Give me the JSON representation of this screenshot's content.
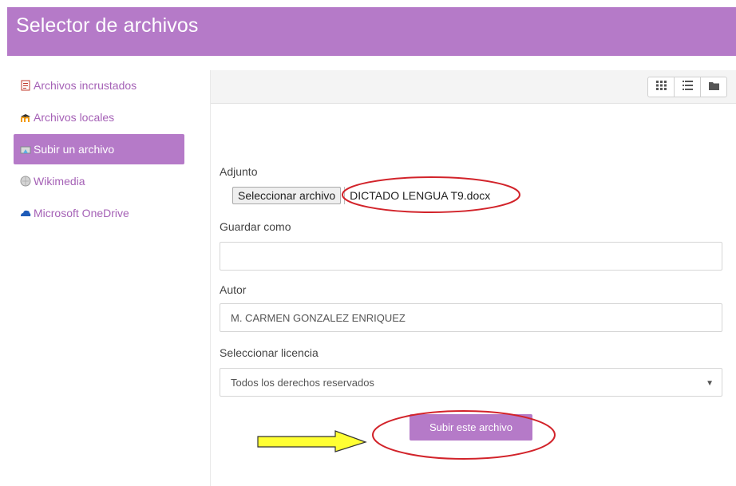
{
  "header": {
    "title": "Selector de archivos"
  },
  "sidebar": {
    "items": [
      {
        "label": "Archivos incrustados",
        "icon": "embedded-files-icon",
        "active": false
      },
      {
        "label": "Archivos locales",
        "icon": "moodle-local-files-icon",
        "active": false
      },
      {
        "label": "Subir un archivo",
        "icon": "upload-icon",
        "active": true
      },
      {
        "label": "Wikimedia",
        "icon": "wikimedia-icon",
        "active": false
      },
      {
        "label": "Microsoft OneDrive",
        "icon": "onedrive-cloud-icon",
        "active": false
      }
    ]
  },
  "toolbar": {
    "views": [
      {
        "icon": "grid-view-icon"
      },
      {
        "icon": "list-view-icon"
      },
      {
        "icon": "folder-view-icon"
      }
    ]
  },
  "form": {
    "attachment_label": "Adjunto",
    "file_button_label": "Seleccionar archivo",
    "file_name": "DICTADO LENGUA T9.docx",
    "save_as_label": "Guardar como",
    "save_as_value": "",
    "author_label": "Autor",
    "author_value": "M. CARMEN GONZALEZ ENRIQUEZ",
    "license_label": "Seleccionar licencia",
    "license_value": "Todos los derechos reservados",
    "submit_label": "Subir este archivo"
  },
  "colors": {
    "accent": "#b57ac8",
    "link": "#a561b6",
    "annotation_ellipse": "#d2232a",
    "annotation_arrow_fill": "#ffff33"
  }
}
